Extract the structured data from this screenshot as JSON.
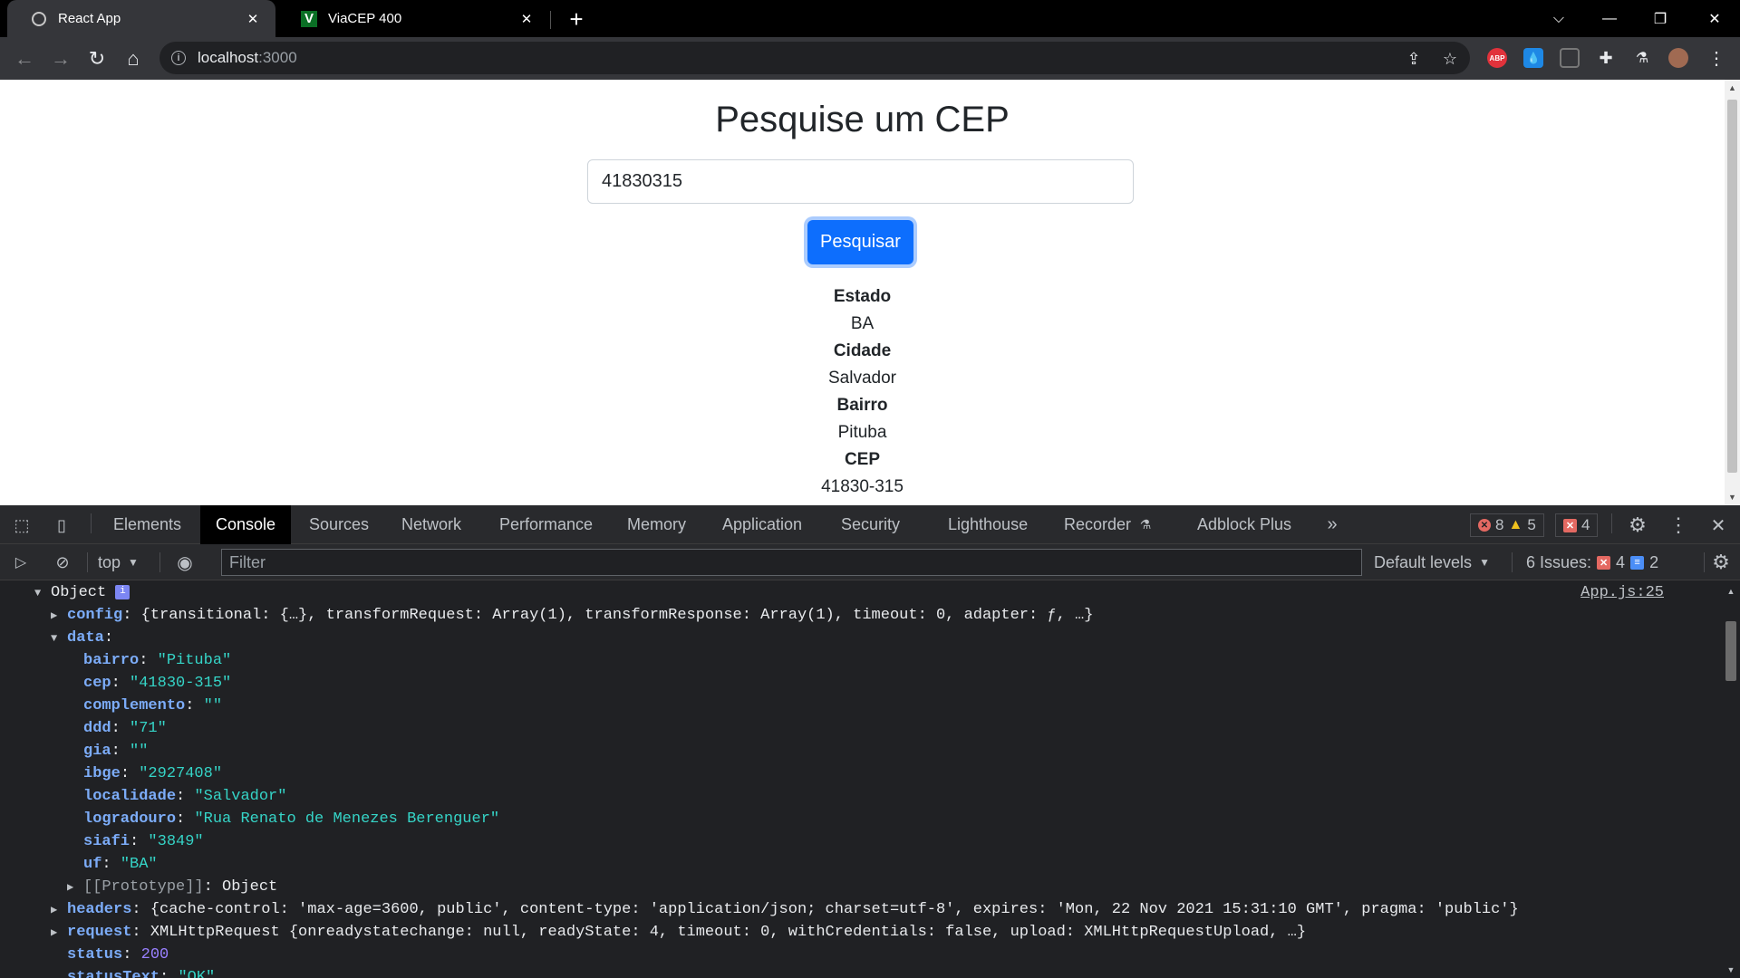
{
  "browser": {
    "tabs": [
      {
        "title": "React App",
        "icon": "globe-icon"
      },
      {
        "title": "ViaCEP 400",
        "icon": "viacep-favicon",
        "favicon_letter": "V"
      }
    ],
    "address": {
      "host": "localhost",
      "port": ":3000"
    }
  },
  "page": {
    "title": "Pesquise um CEP",
    "input_value": "41830315",
    "button_label": "Pesquisar",
    "results": [
      {
        "label": "Estado",
        "value": "BA"
      },
      {
        "label": "Cidade",
        "value": "Salvador"
      },
      {
        "label": "Bairro",
        "value": "Pituba"
      },
      {
        "label": "CEP",
        "value": "41830-315"
      }
    ]
  },
  "devtools": {
    "tabs": [
      "Elements",
      "Console",
      "Sources",
      "Network",
      "Performance",
      "Memory",
      "Application",
      "Security",
      "Lighthouse",
      "Recorder",
      "Adblock Plus"
    ],
    "active_tab": "Console",
    "error_count": "8",
    "warning_count": "5",
    "issue_count_top": "4",
    "context": "top",
    "filter_placeholder": "Filter",
    "levels": "Default levels",
    "issues_label": "6 Issues:",
    "issues_errors": "4",
    "issues_info": "2",
    "source_link": "App.js:25",
    "console": {
      "object_label": "Object",
      "config_key": "config",
      "config_summary": "{transitional: {…}, transformRequest: Array(1), transformResponse: Array(1), timeout: 0, adapter: ƒ, …}",
      "data_key": "data",
      "data": [
        {
          "key": "bairro",
          "value": "\"Pituba\""
        },
        {
          "key": "cep",
          "value": "\"41830-315\""
        },
        {
          "key": "complemento",
          "value": "\"\""
        },
        {
          "key": "ddd",
          "value": "\"71\""
        },
        {
          "key": "gia",
          "value": "\"\""
        },
        {
          "key": "ibge",
          "value": "\"2927408\""
        },
        {
          "key": "localidade",
          "value": "\"Salvador\""
        },
        {
          "key": "logradouro",
          "value": "\"Rua Renato de Menezes Berenguer\""
        },
        {
          "key": "siafi",
          "value": "\"3849\""
        },
        {
          "key": "uf",
          "value": "\"BA\""
        }
      ],
      "prototype_key": "[[Prototype]]",
      "prototype_value": "Object",
      "headers_key": "headers",
      "headers_summary": "{cache-control: 'max-age=3600, public', content-type: 'application/json; charset=utf-8', expires: 'Mon, 22 Nov 2021 15:31:10 GMT', pragma: 'public'}",
      "request_key": "request",
      "request_summary": "XMLHttpRequest {onreadystatechange: null, readyState: 4, timeout: 0, withCredentials: false, upload: XMLHttpRequestUpload, …}",
      "status_key": "status",
      "status_value": "200",
      "statustext_key": "statusText",
      "statustext_value": "\"OK\""
    }
  }
}
